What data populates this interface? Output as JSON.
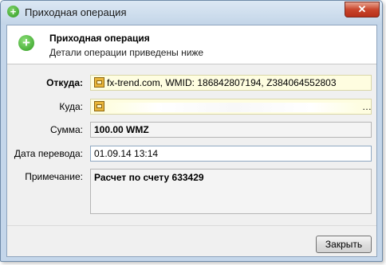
{
  "window": {
    "title": "Приходная операция",
    "close_glyph": "✕"
  },
  "header": {
    "title": "Приходная операция",
    "subtitle": "Детали операции приведены ниже",
    "icon": "plus-circle-icon"
  },
  "form": {
    "from_label": "Откуда:",
    "from_value": "fx-trend.com, WMID: 186842807194, Z384064552803",
    "to_label": "Куда:",
    "to_value_suffix": "…",
    "amount_label": "Сумма:",
    "amount_value": "100.00 WMZ",
    "date_label": "Дата перевода:",
    "date_value": "01.09.14 13:14",
    "note_label": "Примечание:",
    "note_value": "Расчет по счету 633429"
  },
  "buttons": {
    "close_label": "Закрыть"
  },
  "colors": {
    "accent_green": "#2e9a1f",
    "field_yellow": "#fefde0",
    "close_red": "#c9462c"
  }
}
